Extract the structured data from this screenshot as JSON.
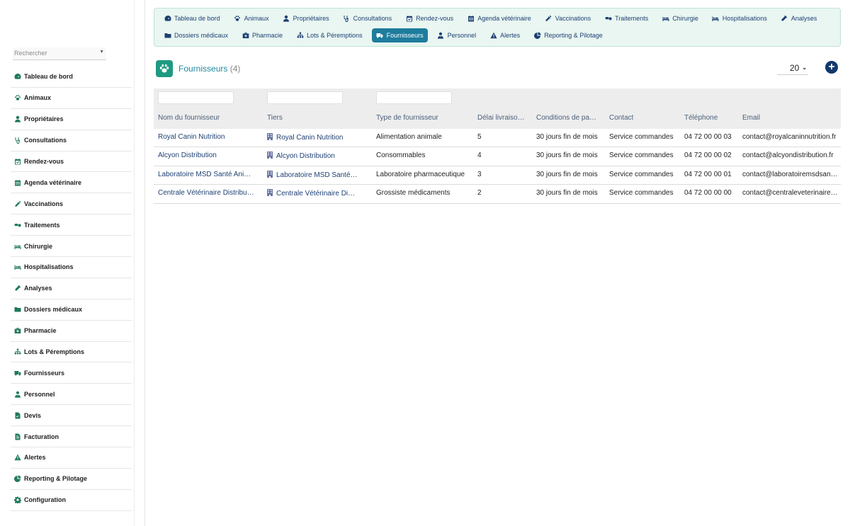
{
  "sidebar": {
    "search_placeholder": "Rechercher",
    "items": [
      {
        "label": "Tableau de bord",
        "icon": "dashboard-icon"
      },
      {
        "label": "Animaux",
        "icon": "paw-icon"
      },
      {
        "label": "Propriétaires",
        "icon": "user-icon"
      },
      {
        "label": "Consultations",
        "icon": "stethoscope-icon"
      },
      {
        "label": "Rendez-vous",
        "icon": "calendar-check-icon"
      },
      {
        "label": "Agenda vétérinaire",
        "icon": "calendar-icon"
      },
      {
        "label": "Vaccinations",
        "icon": "syringe-icon"
      },
      {
        "label": "Traitements",
        "icon": "pills-icon"
      },
      {
        "label": "Chirurgie",
        "icon": "procedure-bed-icon"
      },
      {
        "label": "Hospitalisations",
        "icon": "bed-icon"
      },
      {
        "label": "Analyses",
        "icon": "vial-icon"
      },
      {
        "label": "Dossiers médicaux",
        "icon": "folder-icon"
      },
      {
        "label": "Pharmacie",
        "icon": "medkit-icon"
      },
      {
        "label": "Lots & Péremptions",
        "icon": "sitemap-icon"
      },
      {
        "label": "Fournisseurs",
        "icon": "truck-icon"
      },
      {
        "label": "Personnel",
        "icon": "user-tie-icon"
      },
      {
        "label": "Devis",
        "icon": "file-signature-icon"
      },
      {
        "label": "Facturation",
        "icon": "invoice-icon"
      },
      {
        "label": "Alertes",
        "icon": "warning-icon"
      },
      {
        "label": "Reporting & Pilotage",
        "icon": "chart-pie-icon"
      },
      {
        "label": "Configuration",
        "icon": "gear-icon"
      }
    ]
  },
  "topnav": {
    "row1": [
      {
        "label": "Tableau de bord",
        "icon": "dashboard-icon"
      },
      {
        "label": "Animaux",
        "icon": "paw-icon"
      },
      {
        "label": "Propriétaires",
        "icon": "user-icon"
      },
      {
        "label": "Consultations",
        "icon": "stethoscope-icon"
      },
      {
        "label": "Rendez-vous",
        "icon": "calendar-check-icon"
      },
      {
        "label": "Agenda vétérinaire",
        "icon": "calendar-icon"
      },
      {
        "label": "Vaccinations",
        "icon": "syringe-icon"
      },
      {
        "label": "Traitements",
        "icon": "pills-icon"
      },
      {
        "label": "Chirurgie",
        "icon": "procedure-bed-icon"
      },
      {
        "label": "Hospitalisations",
        "icon": "bed-icon"
      },
      {
        "label": "Analyses",
        "icon": "vial-icon"
      }
    ],
    "row2": [
      {
        "label": "Dossiers médicaux",
        "icon": "folder-icon"
      },
      {
        "label": "Pharmacie",
        "icon": "medkit-icon"
      },
      {
        "label": "Lots & Péremptions",
        "icon": "sitemap-icon"
      },
      {
        "label": "Fournisseurs",
        "icon": "truck-icon",
        "active": true
      },
      {
        "label": "Personnel",
        "icon": "user-tie-icon"
      },
      {
        "label": "Alertes",
        "icon": "warning-icon"
      },
      {
        "label": "Reporting & Pilotage",
        "icon": "chart-pie-icon"
      }
    ]
  },
  "page": {
    "title": "Fournisseurs",
    "count": "(4)",
    "per_page": "20"
  },
  "table": {
    "columns": [
      "Nom du fournisseur",
      "Tiers",
      "Type de fournisseur",
      "Délai livraiso…",
      "Conditions de pa…",
      "Contact",
      "Téléphone",
      "Email"
    ],
    "rows": [
      [
        "Royal Canin Nutrition",
        "Royal Canin Nutrition",
        "Alimentation animale",
        "5",
        "30 jours fin de mois",
        "Service commandes",
        "04 72 00 00 03",
        "contact@royalcaninnutrition.fr"
      ],
      [
        "Alcyon Distribution",
        "Alcyon Distribution",
        "Consommables",
        "4",
        "30 jours fin de mois",
        "Service commandes",
        "04 72 00 00 02",
        "contact@alcyondistribution.fr"
      ],
      [
        "Laboratoire MSD Santé Ani…",
        "Laboratoire MSD Santé …",
        "Laboratoire pharmaceutique",
        "3",
        "30 jours fin de mois",
        "Service commandes",
        "04 72 00 00 01",
        "contact@laboratoiremsdsan…"
      ],
      [
        "Centrale Vétérinaire Distribu…",
        "Centrale Vétérinaire Dist…",
        "Grossiste médicaments",
        "2",
        "30 jours fin de mois",
        "Service commandes",
        "04 72 00 00 00",
        "contact@centraleveterinaire…"
      ]
    ]
  },
  "colors": {
    "accent": "#1e7c9c",
    "nav_bg": "#e9f6f1",
    "link": "#1d3f73",
    "icon_green": "#1f7a5a"
  }
}
